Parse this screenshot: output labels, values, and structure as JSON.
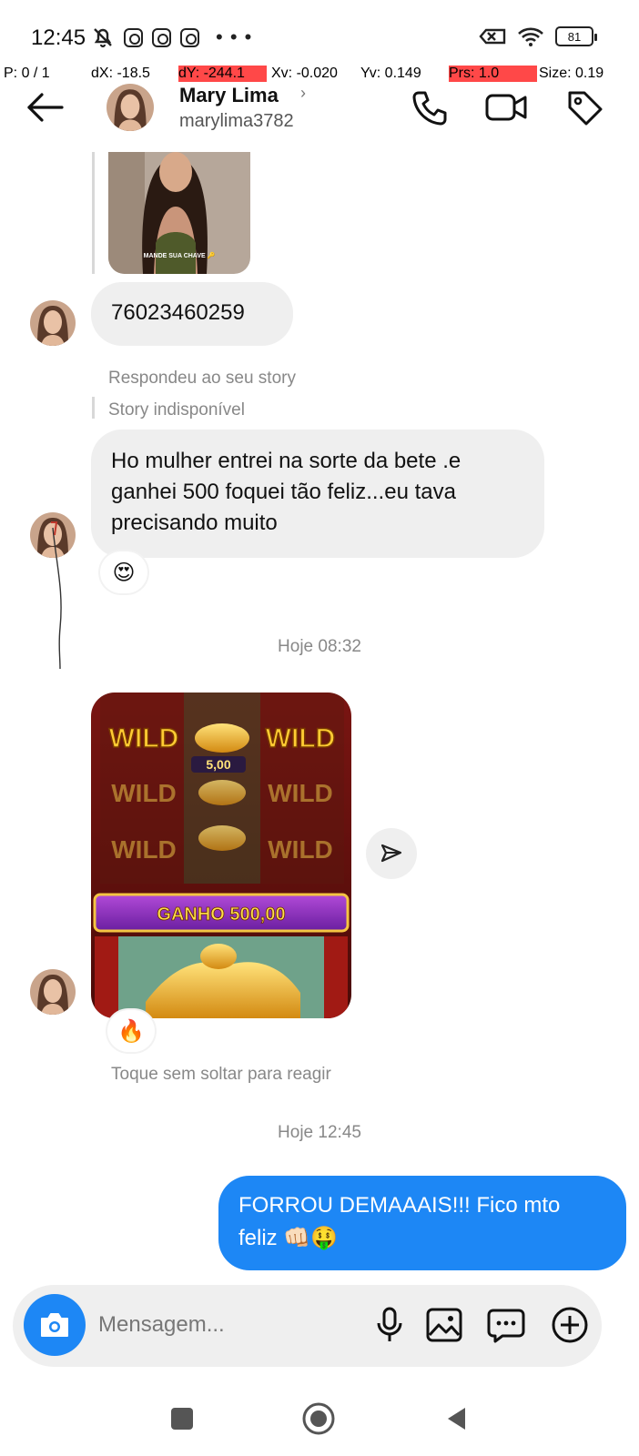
{
  "status_bar": {
    "time": "12:45",
    "battery": "81",
    "icons": [
      "silent-bell-icon",
      "instagram-icon",
      "instagram-icon",
      "instagram-icon",
      "more-dots-icon",
      "no-sim-icon",
      "wifi-icon",
      "battery-icon"
    ]
  },
  "debug_overlay": {
    "p": "P: 0 / 1",
    "dx": "dX: -18.5",
    "dy": "dY: -244.1",
    "xv": "Xv: -0.020",
    "yv": "Yv: 0.149",
    "prs": "Prs: 1.0",
    "size": "Size: 0.19",
    "highlight_color": "#ff4848"
  },
  "header": {
    "name": "Mary Lima",
    "chevron": "›",
    "username": "marylima3782"
  },
  "story": {
    "caption": "MANDE SUA CHAVE 🔑"
  },
  "messages": {
    "number_message": "76023460259",
    "story_reply_label": "Respondeu ao seu story",
    "story_unavailable": "Story indisponível",
    "long_message_lines": [
      "Ho mulher entrei na sorte da bete .e",
      "ganhei 500 foquei tão feliz...eu tava",
      "precisando muito"
    ],
    "reaction_1": "😍",
    "timestamp_1": "Hoje 08:32",
    "game": {
      "wild": "WILD",
      "bet_value": "5,00",
      "win_label": "GANHO 500,00"
    },
    "reaction_2": "🔥",
    "hint": "Toque sem soltar para reagir",
    "timestamp_2": "Hoje 12:45",
    "outgoing_lines": [
      "FORROU DEMAAAIS!!! Fico mto",
      "feliz 👊🏻🤑"
    ]
  },
  "composer": {
    "placeholder": "Mensagem..."
  },
  "colors": {
    "accent": "#1d87f5",
    "bubble_in": "#efefef",
    "meta_text": "#888888"
  }
}
